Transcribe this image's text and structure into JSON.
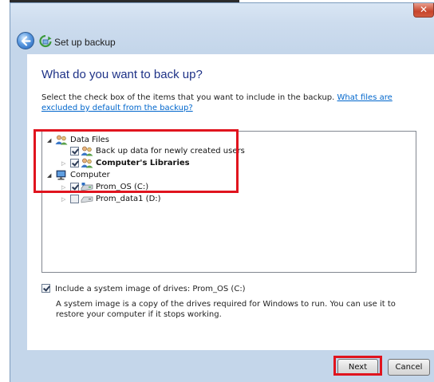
{
  "window": {
    "title": "Set up backup",
    "close_glyph": "✕"
  },
  "main": {
    "heading": "What do you want to back up?",
    "description": "Select the check box of the items that you want to include in the backup.",
    "link": "What files are excluded by default from the backup?"
  },
  "tree": {
    "items": [
      {
        "label": "Data Files",
        "expanded": true,
        "checkbox": "none",
        "icon": "users-icon"
      },
      {
        "label": "Back up data for newly created users",
        "checkbox": "checked",
        "icon": "users-icon"
      },
      {
        "label": "Computer's Libraries",
        "expanded": false,
        "checkbox": "checked",
        "icon": "users-icon",
        "bold": true
      },
      {
        "label": "Computer",
        "expanded": true,
        "checkbox": "none",
        "icon": "computer-icon"
      },
      {
        "label": "Prom_OS (C:)",
        "expanded": false,
        "checkbox": "checked",
        "icon": "drive-icon"
      },
      {
        "label": "Prom_data1 (D:)",
        "expanded": false,
        "checkbox": "unchecked",
        "icon": "drive-icon"
      }
    ]
  },
  "system_image": {
    "checked": true,
    "label": "Include a system image of drives: Prom_OS (C:)",
    "description": "A system image is a copy of the drives required for Windows to run. You can use it to restore your computer if it stops working."
  },
  "buttons": {
    "next": "Next",
    "cancel": "Cancel"
  },
  "colors": {
    "highlight": "#e0141e",
    "heading": "#1e3287",
    "link": "#0066cc"
  }
}
